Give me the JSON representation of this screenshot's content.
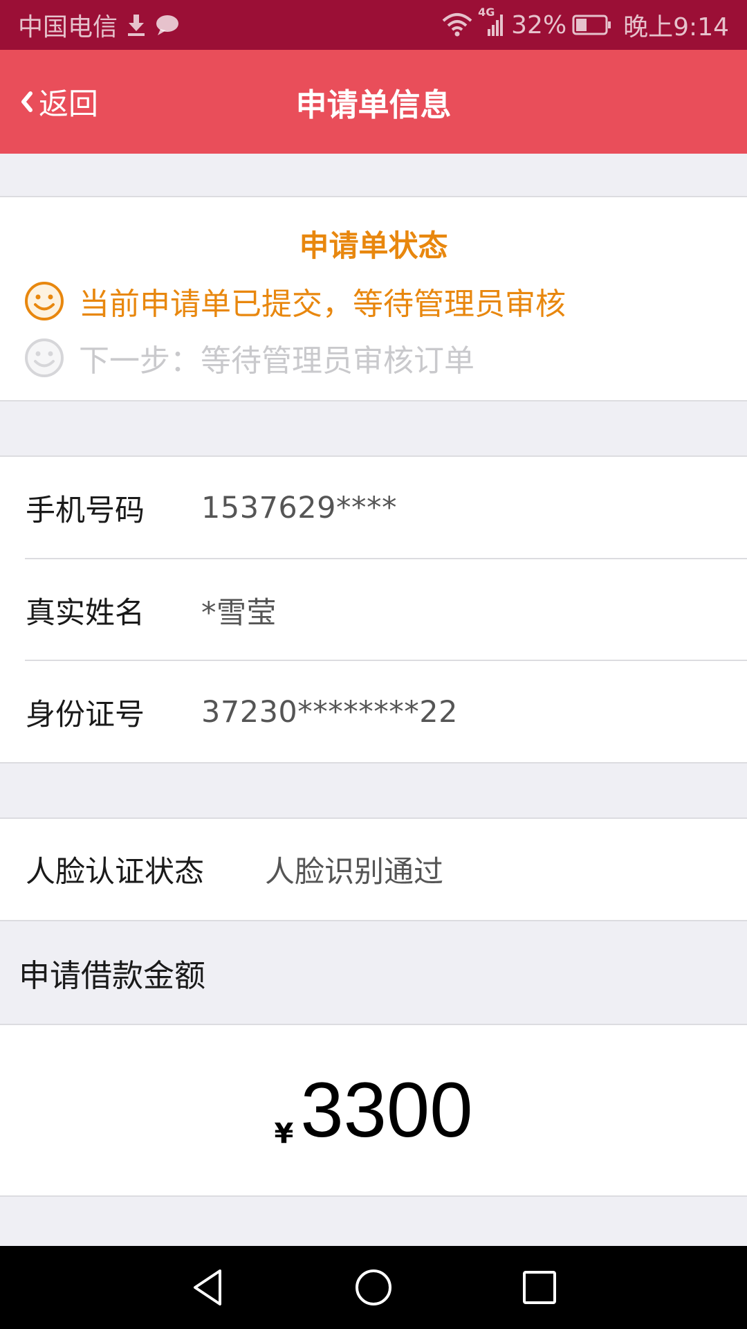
{
  "status_bar": {
    "carrier": "中国电信",
    "network": "4G",
    "battery": "32%",
    "time": "晚上9:14"
  },
  "nav": {
    "back_label": "返回",
    "title": "申请单信息"
  },
  "application_status": {
    "title": "申请单状态",
    "current": "当前申请单已提交，等待管理员审核",
    "next": "下一步：等待管理员审核订单"
  },
  "info": [
    {
      "label": "手机号码",
      "value": "1537629****"
    },
    {
      "label": "真实姓名",
      "value": "*雪莹"
    },
    {
      "label": "身份证号",
      "value": "37230********22"
    }
  ],
  "face_auth": {
    "label": "人脸认证状态",
    "value": "人脸识别通过"
  },
  "loan": {
    "header": "申请借款金额",
    "currency": "¥",
    "amount": "3300"
  },
  "colors": {
    "status_bar": "#9b0f36",
    "nav_bar": "#e94e5a",
    "status_accent": "#e8870e",
    "page_bg": "#efeff4"
  },
  "icons": {
    "download": "download-icon",
    "message": "message-icon",
    "wifi": "wifi-icon",
    "signal": "signal-icon",
    "battery": "battery-icon",
    "back": "chevron-left-icon",
    "smiley": "smiley-icon",
    "nav_back": "triangle-back-icon",
    "nav_home": "circle-home-icon",
    "nav_recents": "square-recents-icon"
  }
}
